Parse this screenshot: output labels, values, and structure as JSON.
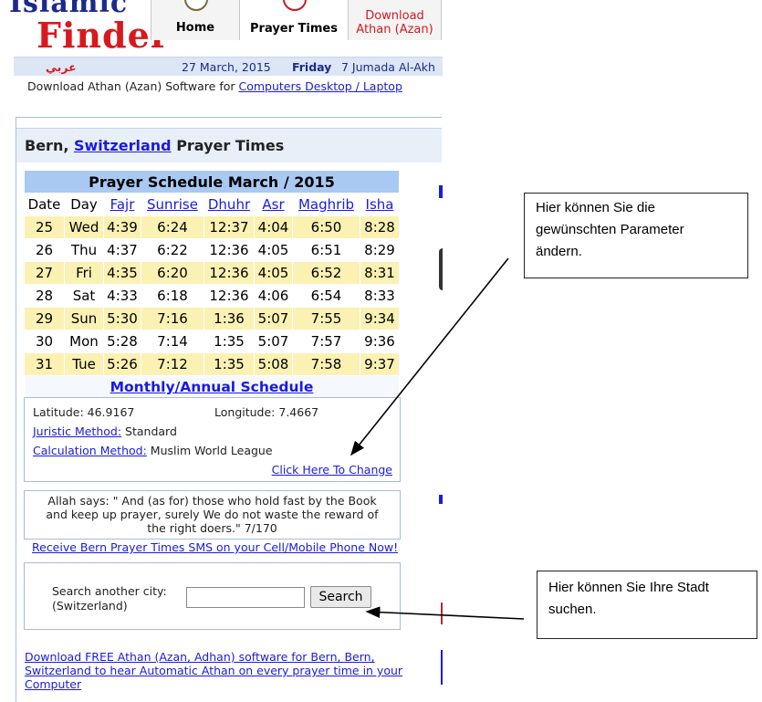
{
  "header": {
    "logo_top": "Islamic",
    "logo_main": "Finder",
    "nav": [
      {
        "label": "Home",
        "icon": "home-icon"
      },
      {
        "label": "Prayer Times",
        "icon": "clock-icon"
      },
      {
        "label_line1": "Download",
        "label_line2": "Athan (Azan)",
        "icon": "download-icon"
      }
    ],
    "arabic_link": "عربي",
    "gregorian_date": "27 March, 2015",
    "weekday": "Friday",
    "hijri_date": "7 Jumada Al-Akh",
    "download_text": "Download Athan (Azan) Software for",
    "download_link": "Computers Desktop / Laptop"
  },
  "page": {
    "city": "Bern,",
    "country_link": "Switzerland",
    "title_suffix": "Prayer Times"
  },
  "schedule": {
    "caption": "Prayer Schedule March / 2015",
    "headers": [
      "Date",
      "Day",
      "Fajr",
      "Sunrise",
      "Dhuhr",
      "Asr",
      "Maghrib",
      "Isha"
    ],
    "rows": [
      [
        "25",
        "Wed",
        "4:39",
        "6:24",
        "12:37",
        "4:04",
        "6:50",
        "8:28"
      ],
      [
        "26",
        "Thu",
        "4:37",
        "6:22",
        "12:36",
        "4:05",
        "6:51",
        "8:29"
      ],
      [
        "27",
        "Fri",
        "4:35",
        "6:20",
        "12:36",
        "4:05",
        "6:52",
        "8:31"
      ],
      [
        "28",
        "Sat",
        "4:33",
        "6:18",
        "12:36",
        "4:06",
        "6:54",
        "8:33"
      ],
      [
        "29",
        "Sun",
        "5:30",
        "7:16",
        "1:36",
        "5:07",
        "7:55",
        "9:34"
      ],
      [
        "30",
        "Mon",
        "5:28",
        "7:14",
        "1:35",
        "5:07",
        "7:57",
        "9:36"
      ],
      [
        "31",
        "Tue",
        "5:26",
        "7:12",
        "1:35",
        "5:08",
        "7:58",
        "9:37"
      ]
    ],
    "monthly_link": "Monthly/Annual Schedule"
  },
  "info": {
    "latitude_label": "Latitude:",
    "latitude": "46.9167",
    "longitude_label": "Longitude:",
    "longitude": "7.4667",
    "juristic_label": "Juristic Method:",
    "juristic_value": "Standard",
    "calc_label": "Calculation Method:",
    "calc_value": "Muslim World League",
    "change_link": "Click Here To Change"
  },
  "quote": {
    "line1": "Allah says: \" And (as for) those who hold fast by the Book",
    "line2": "and keep up prayer, surely We do not waste the reward of",
    "line3": "the right doers.\" 7/170"
  },
  "sms_link": "Receive Bern Prayer Times SMS on your Cell/Mobile Phone Now!",
  "search": {
    "label_line1": "Search another city:",
    "label_line2": "(Switzerland)",
    "input_value": "",
    "button": "Search"
  },
  "download_free": {
    "line1": "Download FREE Athan (Azan, Adhan) software for Bern, Bern,",
    "line2": "Switzerland to hear Automatic Athan on every prayer time in your",
    "line3": "Computer"
  },
  "annotations": {
    "callout_1": {
      "line1": "Hier können Sie die",
      "line2": "gewünschten Parameter",
      "line3": "ändern."
    },
    "callout_2": {
      "line1": "Hier können Sie Ihre Stadt",
      "line2": "suchen."
    }
  },
  "colors": {
    "link": "#1a1ae0",
    "logo_red": "#d8181e",
    "header_blue": "#1b2a8a",
    "table_header": "#a9c9f3",
    "row_highlight": "#fbf1b3"
  }
}
